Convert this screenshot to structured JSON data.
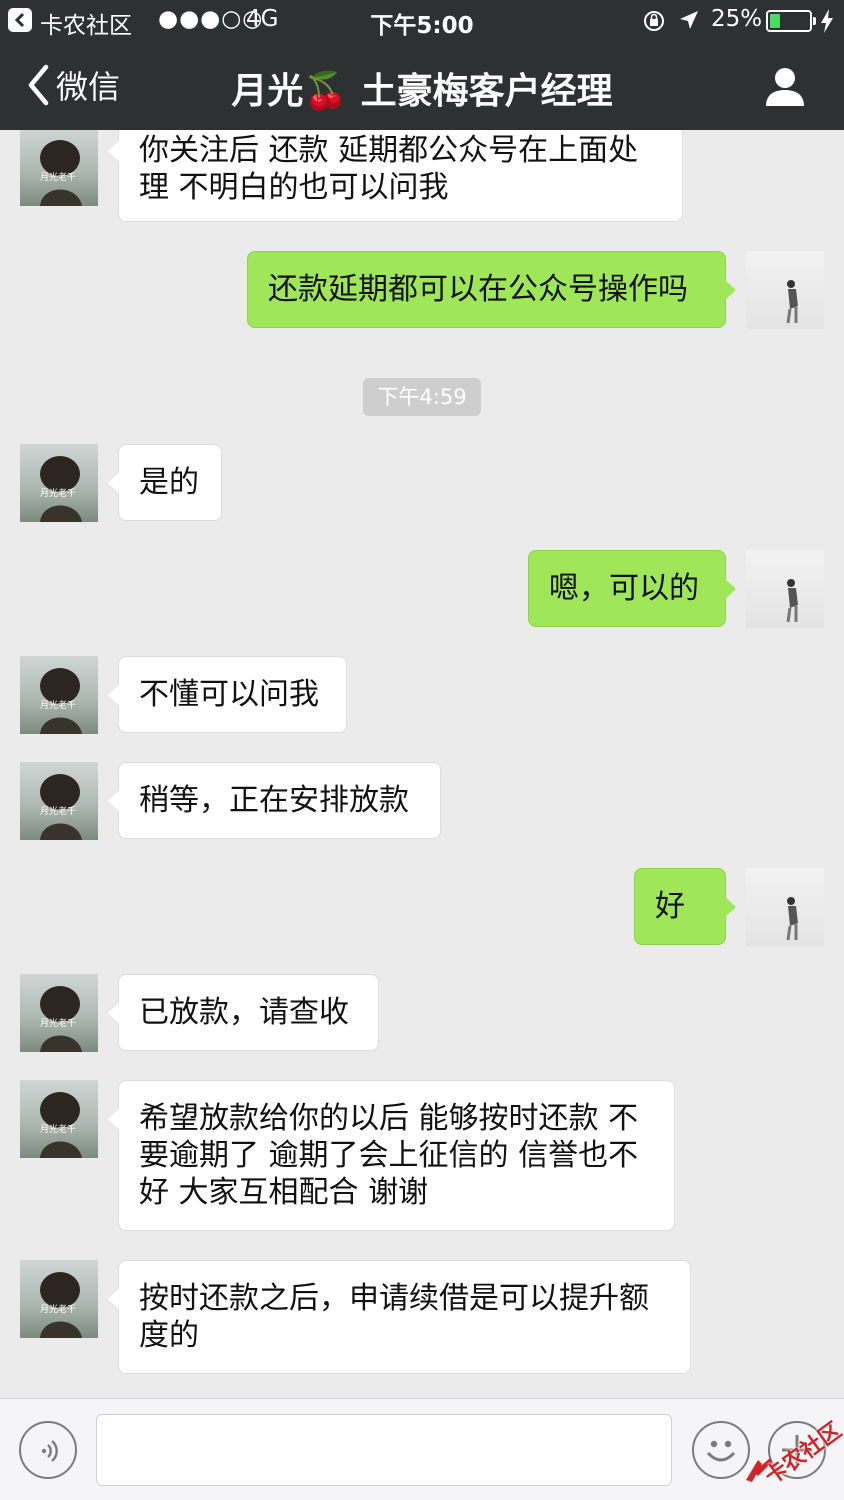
{
  "status_bar": {
    "back_app": "卡农社区",
    "signal": "●●●○○",
    "network": "4G",
    "time": "下午5:00",
    "battery": "25%",
    "battery_level": 0.25
  },
  "nav": {
    "back_label": "微信",
    "title": "月光🍒 土豪梅客户经理",
    "profile_icon": "person-icon"
  },
  "chat": {
    "contact_avatar_caption": "月光老千",
    "timestamp": "下午4:59",
    "messages": [
      {
        "from": "contact",
        "text": "你关注后  还款 延期都公众号在上面处理 不明白的也可以问我"
      },
      {
        "from": "me",
        "text": "还款延期都可以在公众号操作吗"
      },
      {
        "from": "contact",
        "text": "是的"
      },
      {
        "from": "me",
        "text": "嗯，可以的"
      },
      {
        "from": "contact",
        "text": "不懂可以问我"
      },
      {
        "from": "contact",
        "text": "稍等，正在安排放款"
      },
      {
        "from": "me",
        "text": "好"
      },
      {
        "from": "contact",
        "text": "已放款，请查收"
      },
      {
        "from": "contact",
        "text": "希望放款给你的以后 能够按时还款 不要逾期了 逾期了会上征信的 信誉也不好  大家互相配合  谢谢"
      },
      {
        "from": "contact",
        "text": "按时还款之后，申请续借是可以提升额度的"
      }
    ]
  },
  "input_bar": {
    "placeholder": "",
    "voice_icon": "voice-icon",
    "emoji_icon": "emoji-icon",
    "plus_icon": "plus-icon"
  },
  "watermark": "卡农社区",
  "colors": {
    "header_bg": "#2e3132",
    "chat_bg": "#ebebeb",
    "my_bubble": "#9fe658",
    "their_bubble": "#ffffff",
    "battery_fill": "#4cd964",
    "watermark": "#d2232a"
  }
}
